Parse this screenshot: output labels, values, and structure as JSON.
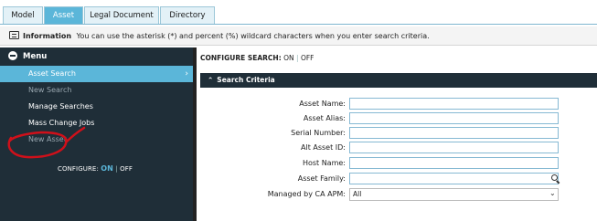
{
  "tabs": [
    {
      "label": "Model"
    },
    {
      "label": "Asset"
    },
    {
      "label": "Legal Document"
    },
    {
      "label": "Directory"
    }
  ],
  "info": {
    "title": "Information",
    "text": "You can use the asterisk (*) and percent (%) wildcard characters when you enter search criteria."
  },
  "sidebar": {
    "menu_label": "Menu",
    "items": [
      {
        "label": "Asset Search",
        "active": true
      },
      {
        "label": "New Search",
        "disabled": true
      },
      {
        "label": "Manage Searches"
      },
      {
        "label": "Mass Change Jobs"
      },
      {
        "label": "New Asset",
        "disabled": true
      }
    ],
    "configure": {
      "label": "CONFIGURE:",
      "on": "ON",
      "off": "OFF"
    }
  },
  "main": {
    "configure_search": {
      "label": "CONFIGURE SEARCH:",
      "on": "ON",
      "off": "OFF"
    },
    "panel_title": "Search Criteria",
    "fields": [
      {
        "label": "Asset Name:",
        "value": ""
      },
      {
        "label": "Asset Alias:",
        "value": ""
      },
      {
        "label": "Serial Number:",
        "value": ""
      },
      {
        "label": "Alt Asset ID:",
        "value": ""
      },
      {
        "label": "Host Name:",
        "value": ""
      },
      {
        "label": "Asset Family:",
        "value": ""
      },
      {
        "label": "Managed by CA APM:",
        "value": "All"
      }
    ]
  },
  "colors": {
    "accent": "#5bb6d9",
    "sidebar_bg": "#1f2e38",
    "annotation": "#d0101a"
  },
  "icons": {
    "info": "info-icon",
    "menu_toggle": "minus-circle-icon",
    "chevron_right": "chevron-right-icon",
    "collapse": "chevron-up-icon",
    "search": "search-icon",
    "dropdown": "chevron-down-icon"
  }
}
